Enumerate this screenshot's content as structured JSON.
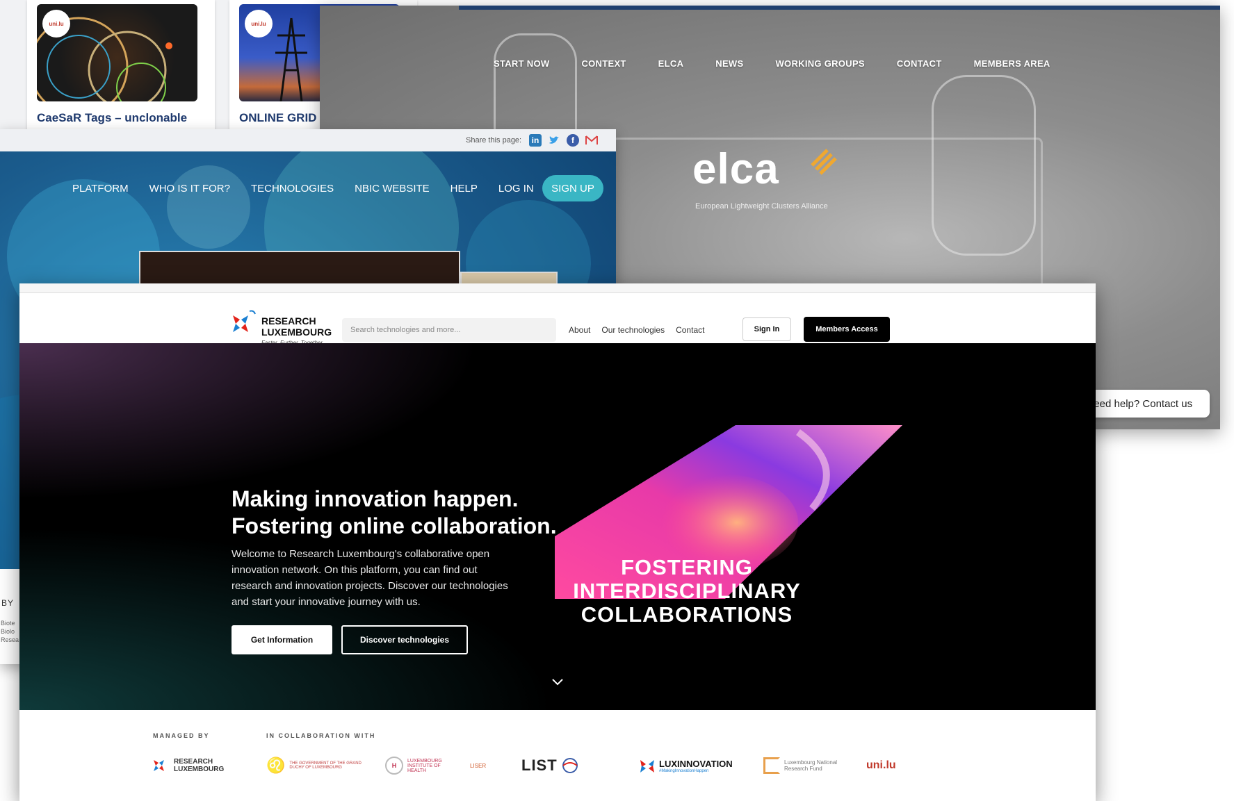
{
  "cards": [
    {
      "title": "CaeSaR Tags – unclonable",
      "badge": "uni.lu"
    },
    {
      "title": "ONLINE GRID",
      "badge": "uni.lu"
    }
  ],
  "elca": {
    "nav": [
      "START NOW",
      "CONTEXT",
      "ELCA",
      "NEWS",
      "WORKING GROUPS",
      "CONTACT",
      "MEMBERS AREA"
    ],
    "logo": "elca",
    "subtitle": "European Lightweight Clusters Alliance",
    "help": "leed help? Contact us"
  },
  "nbic": {
    "share_label": "Share this page:",
    "share_icons": [
      "linkedin-icon",
      "twitter-icon",
      "facebook-icon",
      "mail-icon"
    ],
    "nav": [
      "PLATFORM",
      "WHO IS IT FOR?",
      "TECHNOLOGIES",
      "NBIC WEBSITE",
      "HELP",
      "LOG IN"
    ],
    "signup": "SIGN UP",
    "by_label": "BY",
    "by_sub": [
      "Biote",
      "Biolo",
      "Resea"
    ]
  },
  "rl": {
    "logo_line1": "RESEARCH",
    "logo_line2": "LUXEMBOURG",
    "logo_tag": "Faster. Further. Together.",
    "search_placeholder": "Search technologies and more...",
    "nav": [
      "About",
      "Our technologies",
      "Contact"
    ],
    "signin": "Sign In",
    "members": "Members Access",
    "headline1": "Making innovation happen.",
    "headline2": "Fostering online collaboration.",
    "paragraph": "Welcome to Research Luxembourg's collaborative open innovation network. On this platform, you can find out research and innovation projects. Discover our technologies and start your innovative journey with us.",
    "btn_info": "Get Information",
    "btn_discover": "Discover technologies",
    "art_line1": "FOSTERING",
    "art_line2": "INTERDISCIPLINARY",
    "art_line3": "COLLABORATIONS",
    "managed_by": "MANAGED BY",
    "collab": "IN COLLABORATION WITH",
    "partners": {
      "rl": "RESEARCH LUXEMBOURG",
      "gov": "THE GOVERNMENT OF THE GRAND DUCHY OF LUXEMBOURG",
      "lih": "LUXEMBOURG INSTITUTE OF HEALTH",
      "liser": "LISER",
      "list": "LIST",
      "lxn": "LUXINNOVATION",
      "lxn_tag": "#MakingInnovationHappen",
      "fnr": "Luxembourg National Research Fund",
      "uni": "uni.lu"
    }
  },
  "colors": {
    "elca_blue": "#1f3f6e",
    "nbic_teal": "#3ab6c4",
    "rl_red": "#e2231a",
    "rl_blue": "#1a7fd1",
    "fnr_orange": "#e8a04c"
  }
}
